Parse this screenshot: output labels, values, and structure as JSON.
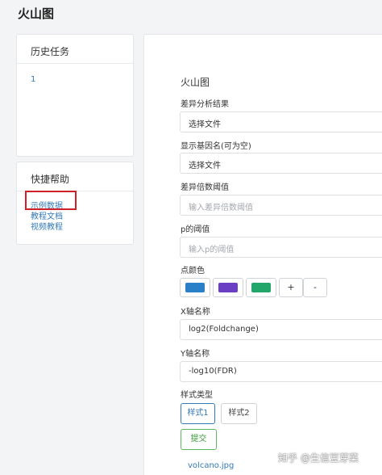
{
  "page": {
    "title": "火山图"
  },
  "history": {
    "title": "历史任务",
    "items": [
      "1"
    ]
  },
  "help": {
    "title": "快捷帮助",
    "links": [
      "示例数据",
      "教程文档",
      "视频教程"
    ],
    "highlight_color": "#d0202a"
  },
  "form": {
    "title": "火山图",
    "diff_label": "差异分析结果",
    "diff_value": "选择文件",
    "gene_label": "显示基因名(可为空)",
    "gene_value": "选择文件",
    "fc_label": "差异倍数阈值",
    "fc_placeholder": "输入差异倍数阈值",
    "p_label": "p的阈值",
    "p_placeholder": "输入p的阈值",
    "color_label": "点颜色",
    "colors": [
      "#2a7fc9",
      "#6a3fc4",
      "#23a66a"
    ],
    "add_label": "+",
    "remove_label": "-",
    "x_label": "X轴名称",
    "x_value": "log2(Foldchange)",
    "y_label": "Y轴名称",
    "y_value": "-log10(FDR)",
    "style_label": "样式类型",
    "style1": "样式1",
    "style2": "样式2",
    "submit": "提交",
    "result_file": "volcano.jpg"
  },
  "watermark": "知乎 @生信豆芽菜"
}
